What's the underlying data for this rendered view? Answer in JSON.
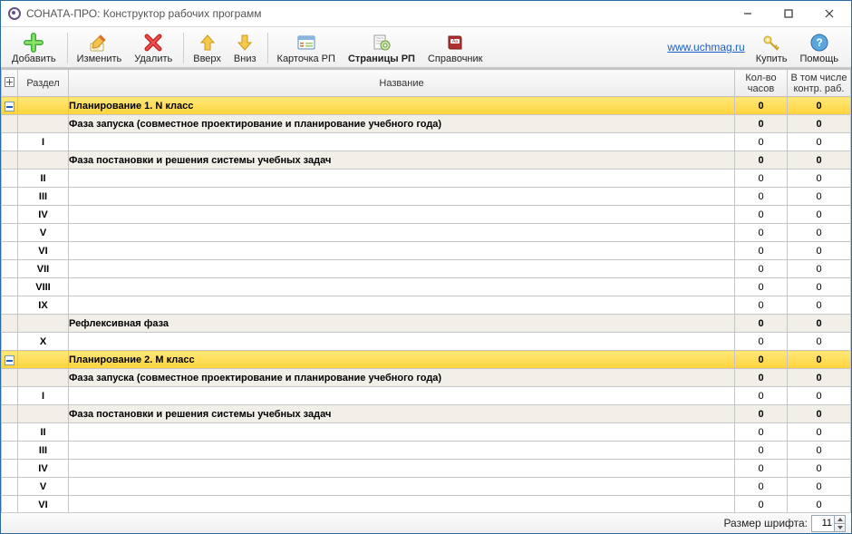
{
  "window": {
    "title": "СОНАТА-ПРО: Конструктор рабочих программ"
  },
  "link": {
    "text": "www.uchmag.ru",
    "href": "#"
  },
  "toolbar": {
    "add": "Добавить",
    "edit": "Изменить",
    "del": "Удалить",
    "up": "Вверх",
    "down": "Вниз",
    "card": "Карточка РП",
    "pages": "Страницы РП",
    "ref": "Справочник",
    "buy": "Купить",
    "help": "Помощь"
  },
  "headers": {
    "section": "Раздел",
    "name": "Название",
    "hours": "Кол-во часов",
    "control": "В том числе контр. раб."
  },
  "rows": [
    {
      "type": "yellow",
      "exp": true,
      "sec": "",
      "name": "Планирование 1. N класс",
      "h": "0",
      "k": "0"
    },
    {
      "type": "grey",
      "sec": "",
      "name": "Фаза запуска (совместное проектирование и  планирование учебного года)",
      "h": "0",
      "k": "0"
    },
    {
      "type": "plain",
      "sec": "I",
      "name": "",
      "h": "0",
      "k": "0"
    },
    {
      "type": "grey",
      "sec": "",
      "name": "Фаза постановки и решения системы учебных задач",
      "h": "0",
      "k": "0"
    },
    {
      "type": "plain",
      "sec": "II",
      "name": "",
      "h": "0",
      "k": "0"
    },
    {
      "type": "plain",
      "sec": "III",
      "name": "",
      "h": "0",
      "k": "0"
    },
    {
      "type": "plain",
      "sec": "IV",
      "name": "",
      "h": "0",
      "k": "0"
    },
    {
      "type": "plain",
      "sec": "V",
      "name": "",
      "h": "0",
      "k": "0"
    },
    {
      "type": "plain",
      "sec": "VI",
      "name": "",
      "h": "0",
      "k": "0"
    },
    {
      "type": "plain",
      "sec": "VII",
      "name": "",
      "h": "0",
      "k": "0"
    },
    {
      "type": "plain",
      "sec": "VIII",
      "name": "",
      "h": "0",
      "k": "0"
    },
    {
      "type": "plain",
      "sec": "IX",
      "name": "",
      "h": "0",
      "k": "0"
    },
    {
      "type": "grey",
      "sec": "",
      "name": "Рефлексивная фаза",
      "h": "0",
      "k": "0"
    },
    {
      "type": "plain",
      "sec": "X",
      "name": "",
      "h": "0",
      "k": "0"
    },
    {
      "type": "yellow",
      "exp": true,
      "sec": "",
      "name": "Планирование 2. M класс",
      "h": "0",
      "k": "0"
    },
    {
      "type": "grey",
      "sec": "",
      "name": "Фаза запуска (совместное проектирование и  планирование учебного года)",
      "h": "0",
      "k": "0"
    },
    {
      "type": "plain",
      "sec": "I",
      "name": "",
      "h": "0",
      "k": "0"
    },
    {
      "type": "grey",
      "sec": "",
      "name": "Фаза постановки и решения системы учебных задач",
      "h": "0",
      "k": "0"
    },
    {
      "type": "plain",
      "sec": "II",
      "name": "",
      "h": "0",
      "k": "0"
    },
    {
      "type": "plain",
      "sec": "III",
      "name": "",
      "h": "0",
      "k": "0"
    },
    {
      "type": "plain",
      "sec": "IV",
      "name": "",
      "h": "0",
      "k": "0"
    },
    {
      "type": "plain",
      "sec": "V",
      "name": "",
      "h": "0",
      "k": "0"
    },
    {
      "type": "plain",
      "sec": "VI",
      "name": "",
      "h": "0",
      "k": "0"
    }
  ],
  "status": {
    "label": "Размер шрифта:",
    "value": "11"
  }
}
